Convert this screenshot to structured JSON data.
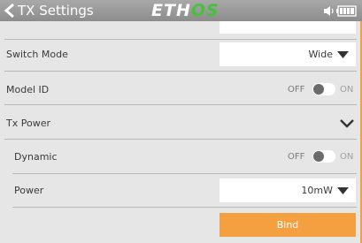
{
  "header": {
    "title": "TX Settings",
    "brand_eth": "ETH",
    "brand_os": "OS",
    "back_icon": "chevron-left-icon",
    "status_icons": [
      "volume-icon",
      "battery-icon"
    ]
  },
  "rows": {
    "switch_mode": {
      "label": "Switch Mode",
      "value": "Wide"
    },
    "model_id": {
      "label": "Model ID",
      "off": "OFF",
      "on": "ON",
      "enabled": false
    },
    "tx_power": {
      "label": "Tx Power",
      "expanded": true
    },
    "dynamic": {
      "label": "Dynamic",
      "off": "OFF",
      "on": "ON",
      "enabled": false
    },
    "power": {
      "label": "Power",
      "value": "10mW"
    },
    "bind": {
      "label": "Bind"
    }
  },
  "colors": {
    "accent": "#f5a040",
    "header": "#9a9a9a",
    "background": "#e6e6e6",
    "brand_os": "#44c23c"
  }
}
